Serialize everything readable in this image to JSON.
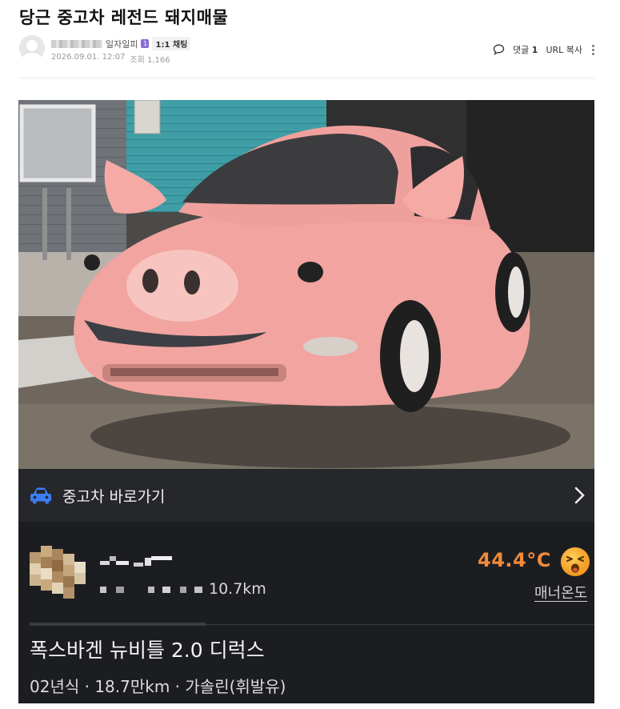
{
  "post": {
    "title": "당근 중고차 레전드 돼지매물",
    "author_tag": "일자일피",
    "level_badge": "1",
    "chat_link": "1:1 채팅",
    "date": "2026.09.01. 12:07",
    "views": "조회 1,166"
  },
  "actions": {
    "comment_label": "댓글",
    "comment_count": "1",
    "url_copy": "URL 복사"
  },
  "market": {
    "used_car_shortcut": "중고차 바로가기",
    "distance": "10.7km",
    "temperature": "44.4°C",
    "manner_label": "매너온도",
    "car_title": "폭스바겐 뉴비틀 2.0 디럭스",
    "car_specs": "02년식 · 18.7만km · 가솔린(휘발유)"
  },
  "colors": {
    "temperature": "#f08a3a",
    "car_icon": "#3d7cf0",
    "panel_bg": "#1c1d21",
    "car_pink": "#f3a7a3"
  }
}
